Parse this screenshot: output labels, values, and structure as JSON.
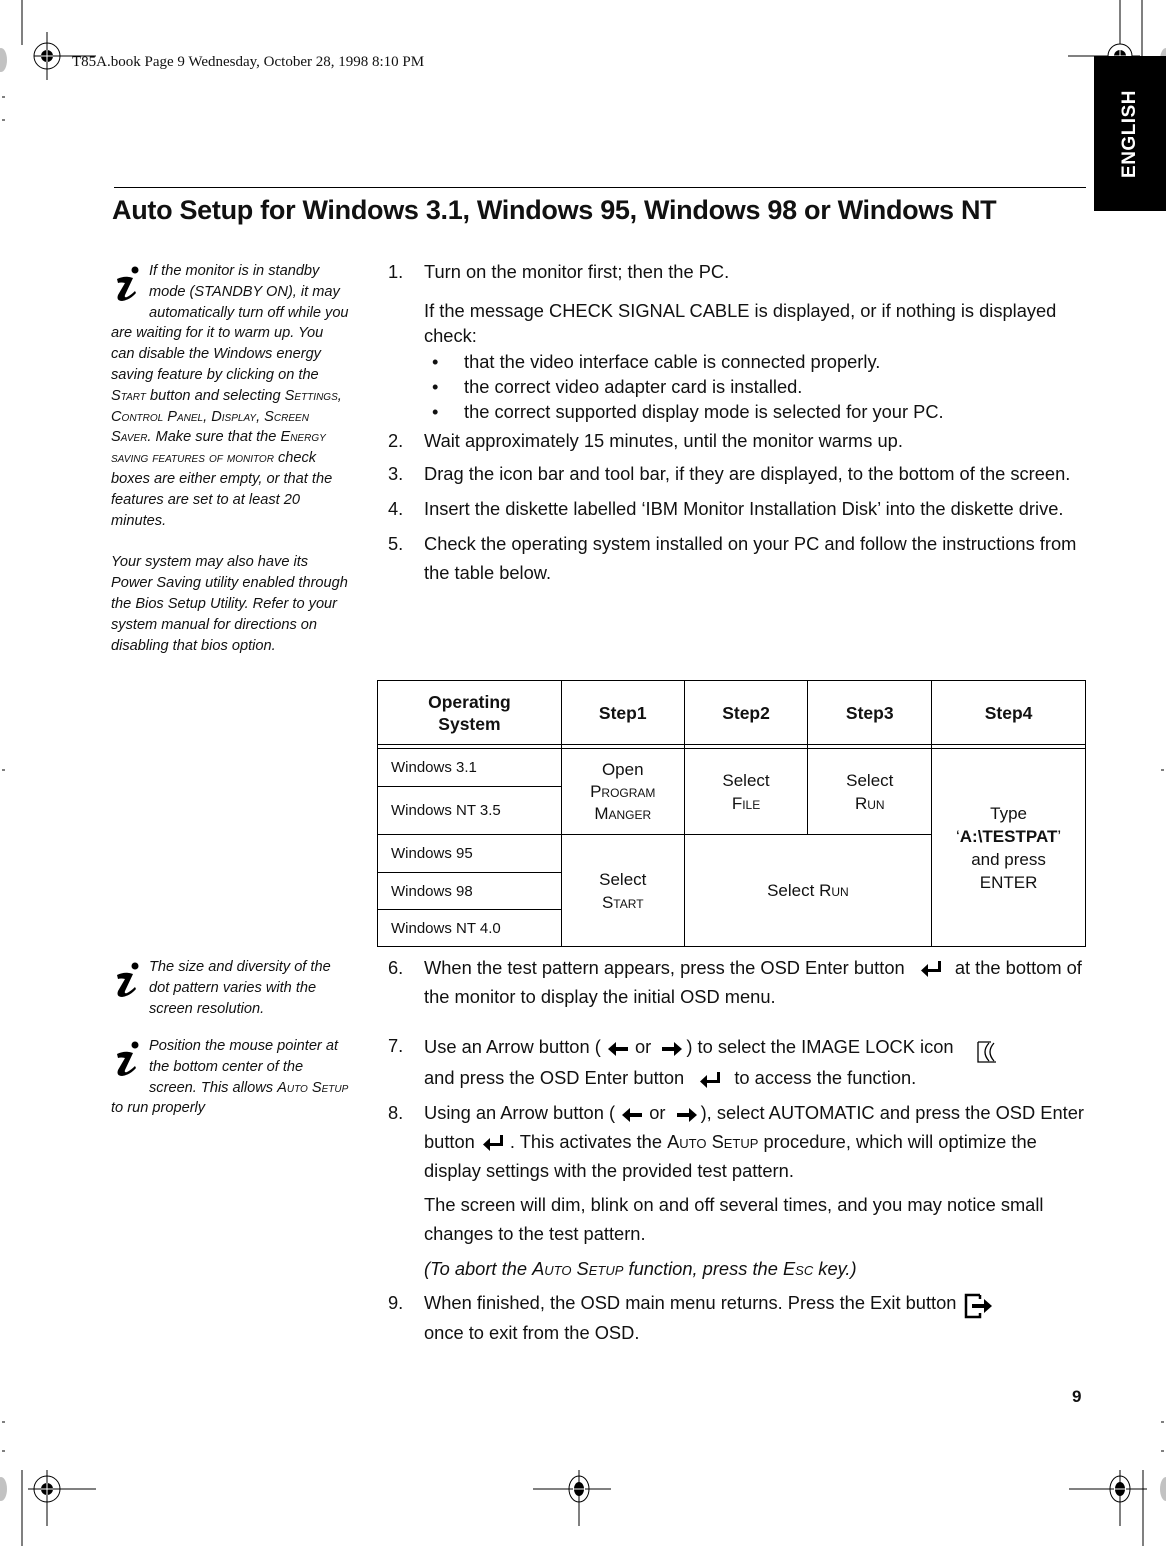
{
  "print_header": "T85A.book  Page 9  Wednesday, October 28, 1998  8:10 PM",
  "language_tab": "ENGLISH",
  "title": "Auto Setup for Windows 3.1, Windows 95, Windows 98 or Windows NT",
  "sidebar_notes": {
    "note1": {
      "icon": "info-icon",
      "p1_parts": [
        "If the monitor is in standby mode (STANDBY ON), it may automatically turn off while you are waiting for it to warm up. You can disable the Windows energy saving feature by clicking on the ",
        "Start",
        " button and selecting ",
        "Settings",
        ", ",
        "Control Panel",
        ", ",
        "Display",
        ", ",
        "Screen Saver",
        ". Make sure that the ",
        "Energy saving features of monitor",
        " check boxes are either empty, or that the features are set to at least 20 minutes."
      ],
      "p2": "Your system may also have its Power Saving utility enabled through the Bios Setup Utility. Refer to your system manual for directions on disabling that bios option."
    },
    "note2": {
      "icon": "info-icon",
      "text": "The size and diversity of the dot pattern varies with the screen resolution."
    },
    "note3": {
      "icon": "info-icon",
      "text_parts": [
        "Position the mouse pointer at the bottom center of the screen. This allows ",
        "Auto Setup",
        " to run properly"
      ]
    }
  },
  "steps": {
    "s1": {
      "num": "1.",
      "text": "Turn on the monitor first; then the PC."
    },
    "s1_detail": "If the message CHECK SIGNAL CABLE is displayed, or if nothing is displayed check:",
    "s1_bullets": [
      "that the video interface cable is connected properly.",
      "the correct video adapter card is installed.",
      "the correct supported display mode is selected for your PC."
    ],
    "s2": {
      "num": "2.",
      "text": "Wait approximately 15 minutes, until the monitor warms up."
    },
    "s3": {
      "num": "3.",
      "text": "Drag the icon bar and tool bar, if they are displayed, to the bottom of the screen."
    },
    "s4": {
      "num": "4.",
      "text": "Insert the diskette labelled ‘IBM Monitor Installation Disk’ into the diskette drive."
    },
    "s5": {
      "num": "5.",
      "text": "Check the operating system installed on your PC and follow the instructions from the table below."
    },
    "s6": {
      "num": "6.",
      "a": "When the test pattern appears, press the OSD Enter button",
      "b": "at the bottom of the monitor to display the initial OSD menu."
    },
    "s7": {
      "num": "7.",
      "a": "Use an Arrow button (",
      "or": "or",
      "b": ") to select the IMAGE LOCK icon",
      "c": "and press the OSD Enter button",
      "d": "to access the function."
    },
    "s8": {
      "num": "8.",
      "a": "Using an Arrow button (",
      "or": "or",
      "b": "), select AUTOMATIC and press the OSD Enter button",
      "c": ". This activates the ",
      "sc1": "Auto Setup",
      "d": " procedure, which will optimize the display settings with the provided test pattern."
    },
    "s8_detail": "The screen will dim, blink on and off several times, and you may notice small changes to the test pattern.",
    "s8_note": {
      "a": "(To abort the ",
      "sc1": "Auto Setup",
      "b": " function, press the ",
      "sc2": "Esc",
      "c": " key.)"
    },
    "s9": {
      "num": "9.",
      "a": "When finished, the OSD main menu returns. Press the Exit button",
      "b": "once to exit from the OSD."
    }
  },
  "table": {
    "headers": [
      "Operating System",
      "Step1",
      "Step2",
      "Step3",
      "Step4"
    ],
    "os": [
      "Windows 3.1",
      "Windows NT 3.5",
      "Windows 95",
      "Windows 98",
      "Windows NT 4.0"
    ],
    "group1": {
      "step1": {
        "line1": "Open",
        "line2": "Program",
        "line3": "Manger"
      },
      "step2": {
        "line1": "Select",
        "line2": "File"
      },
      "step3": {
        "line1": "Select",
        "line2": "Run"
      }
    },
    "group2": {
      "step1": {
        "line1": "Select",
        "line2": "Start"
      },
      "step23": {
        "a": "Select ",
        "b": "Run"
      }
    },
    "step4": {
      "line1": "Type",
      "q1": "‘",
      "bold": "A:\\TESTPAT",
      "q2": "’",
      "line3": "and press",
      "line4": "ENTER"
    }
  },
  "page_number": "9"
}
